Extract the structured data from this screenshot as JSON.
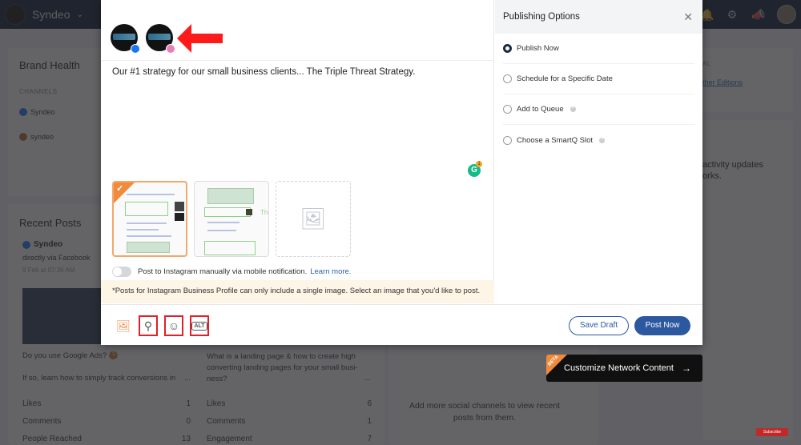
{
  "topbar": {
    "brand_name": "Syndeo",
    "icons": [
      "menu-icon",
      "bell-icon",
      "gear-icon",
      "megaphone-icon",
      "user-avatar"
    ]
  },
  "background": {
    "brand_health": {
      "title": "Brand Health",
      "channels_label": "CHANNELS",
      "channels": [
        {
          "name": "Syndeo",
          "network": "facebook"
        },
        {
          "name": "syndeo",
          "network": "instagram"
        }
      ]
    },
    "right_panel": {
      "partial_label": "AL",
      "partial_link": "ther Editions",
      "activity_text_1": "activity updates",
      "activity_text_2": "orks."
    },
    "recent_posts": {
      "title": "Recent Posts",
      "posts": [
        {
          "author": "Syndeo",
          "via": "directly via Facebook",
          "date": "9 Feb at 07:36 AM",
          "text_1": "Do you use Google Ads? 🍪",
          "text_2": "If so, learn how to simply track conversions in",
          "more": "...",
          "stats": [
            {
              "label": "Likes",
              "value": "1"
            },
            {
              "label": "Comments",
              "value": "0"
            },
            {
              "label": "People Reached",
              "value": "13"
            }
          ]
        },
        {
          "text_1": "What is a landing page & how to create high converting landing pages for your small busi-ness?",
          "more": "...",
          "stats": [
            {
              "label": "Likes",
              "value": "6"
            },
            {
              "label": "Comments",
              "value": "1"
            },
            {
              "label": "Engagement",
              "value": "7"
            }
          ]
        }
      ],
      "empty_msg": "Add more social channels to view recent posts from them."
    }
  },
  "composer": {
    "accounts": [
      {
        "name": "Syndeo",
        "network": "facebook",
        "badge_color": "#1877f2"
      },
      {
        "name": "syndeo",
        "network": "instagram",
        "badge_color": "#e1306c"
      }
    ],
    "post_text": "Our #1 strategy for our small business clients... The Triple Threat Strategy.",
    "grammarly_count": "1",
    "thumbnails": [
      {
        "selected": true
      },
      {
        "selected": false,
        "overlay_text": "The"
      },
      {
        "add_placeholder": true
      }
    ],
    "toggle_label": "Post to Instagram manually via mobile notification.",
    "learn_more": "Learn more.",
    "notice": "*Posts for Instagram Business Profile can only include a single image. Select an image that you'd like to post.",
    "toolbar": [
      {
        "icon": "media-library-icon",
        "boxed": false
      },
      {
        "icon": "image-search-icon",
        "boxed": true
      },
      {
        "icon": "emoji-icon",
        "boxed": true
      },
      {
        "icon": "alt-text-icon",
        "boxed": true,
        "glyph": "ALT"
      }
    ],
    "save_draft": "Save Draft",
    "post_now": "Post Now"
  },
  "publishing": {
    "title": "Publishing Options",
    "options": [
      {
        "label": "Publish Now",
        "selected": true,
        "help": false
      },
      {
        "label": "Schedule for a Specific Date",
        "selected": false,
        "help": false
      },
      {
        "label": "Add to Queue",
        "selected": false,
        "help": true
      },
      {
        "label": "Choose a SmartQ Slot",
        "selected": false,
        "help": true
      }
    ]
  },
  "customize_network": {
    "beta": "BETA",
    "label": "Customize Network Content",
    "arrow": "→"
  },
  "youtube": {
    "subscribe": "Subscribe"
  },
  "colors": {
    "primary": "#2c58a0",
    "navbar": "#0d1c33",
    "highlight_red": "#e0202a",
    "beta_orange": "#ef8a3c",
    "notice_bg": "#fdf5e6"
  }
}
